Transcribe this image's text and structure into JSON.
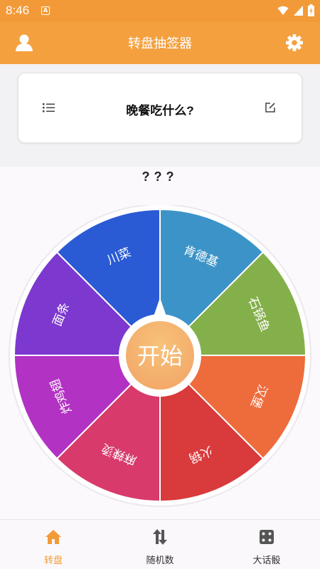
{
  "status_bar": {
    "time": "8:46",
    "notification_icon": "A"
  },
  "app_bar": {
    "title": "转盘抽签器",
    "left_icon": "person-icon",
    "right_icon": "gear-icon"
  },
  "question": {
    "title": "晚餐吃什么?",
    "left_icon": "list-icon",
    "right_icon": "edit-icon"
  },
  "result_text": "???",
  "wheel": {
    "center_label": "开始",
    "segments": [
      {
        "label": "肯德基",
        "color": "#3c93c8"
      },
      {
        "label": "石锅鱼",
        "color": "#84b04c"
      },
      {
        "label": "汉堡",
        "color": "#ee6c3c"
      },
      {
        "label": "火锅",
        "color": "#d93a3c"
      },
      {
        "label": "麻辣烫",
        "color": "#d83a6c"
      },
      {
        "label": "炸鸡翅",
        "color": "#b232c4"
      },
      {
        "label": "面条",
        "color": "#7c38cf"
      },
      {
        "label": "川菜",
        "color": "#2a5bd4"
      }
    ]
  },
  "tabs": [
    {
      "label": "转盘",
      "icon": "home-icon",
      "active": true
    },
    {
      "label": "随机数",
      "icon": "shuffle-icon",
      "active": false
    },
    {
      "label": "大话骰",
      "icon": "dice-icon",
      "active": false
    }
  ],
  "colors": {
    "accent": "#f39a38",
    "app_bar": "#f4a03f"
  }
}
